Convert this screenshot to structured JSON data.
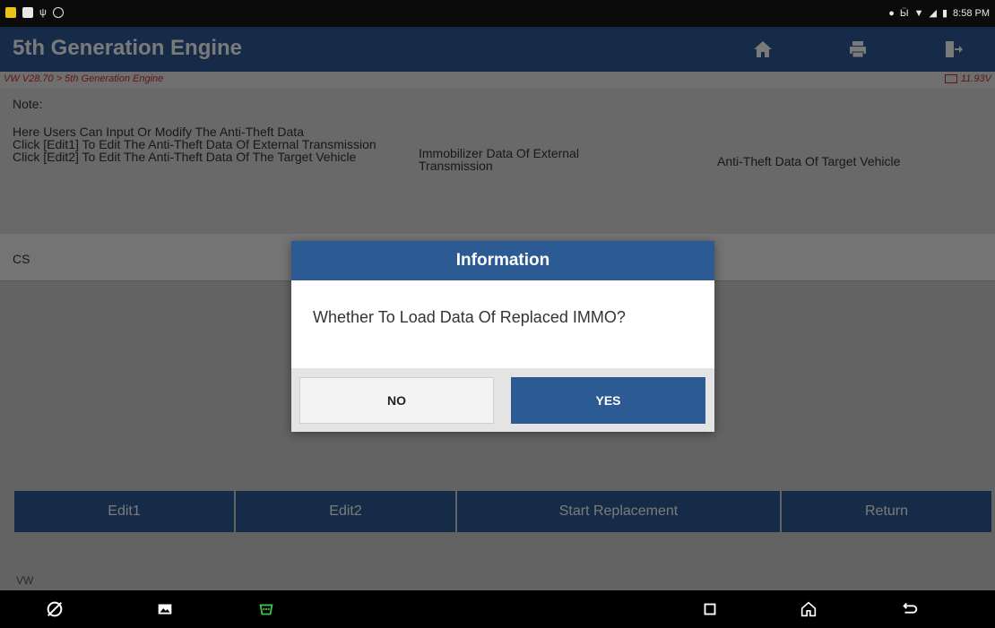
{
  "statusbar": {
    "time": "8:58 PM"
  },
  "header": {
    "title": "5th Generation Engine"
  },
  "breadcrumb": {
    "path": "VW V28.70 > 5th Generation Engine",
    "voltage": "11.93V"
  },
  "notes": {
    "label": "Note:",
    "text": "Here Users Can Input Or Modify The Anti-Theft Data\nClick [Edit1] To Edit The Anti-Theft Data Of External Transmission\nClick [Edit2] To Edit The Anti-Theft Data Of The Target Vehicle",
    "col2": "Immobilizer Data Of External Transmission",
    "col3": "Anti-Theft Data Of Target Vehicle"
  },
  "row": {
    "label": "CS"
  },
  "buttons": {
    "edit1": "Edit1",
    "edit2": "Edit2",
    "start": "Start Replacement",
    "return": "Return"
  },
  "footer": {
    "brand": "VW"
  },
  "dialog": {
    "title": "Information",
    "message": "Whether To Load Data Of Replaced IMMO?",
    "no": "NO",
    "yes": "YES"
  },
  "colors": {
    "primary": "#2c5b94",
    "alert": "#cc2c2c"
  }
}
